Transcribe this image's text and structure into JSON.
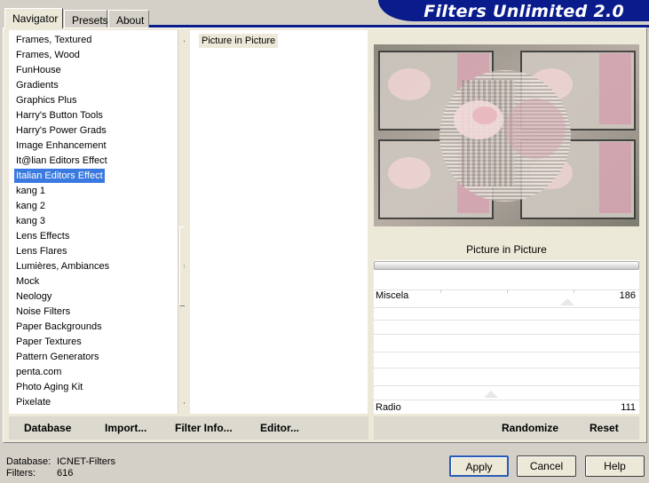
{
  "tabs": [
    {
      "label": "Navigator"
    },
    {
      "label": "Presets"
    },
    {
      "label": "About"
    }
  ],
  "app_title": "Filters Unlimited 2.0",
  "filter_list": [
    "Frames, Textured",
    "Frames, Wood",
    "FunHouse",
    "Gradients",
    "Graphics Plus",
    "Harry's Button Tools",
    "Harry's Power Grads",
    "Image Enhancement",
    "It@lian Editors Effect",
    "Italian Editors Effect",
    "kang 1",
    "kang 2",
    "kang 3",
    "Lens Effects",
    "Lens Flares",
    "Lumières, Ambiances",
    "Mock",
    "Neology",
    "Noise Filters",
    "Paper Backgrounds",
    "Paper Textures",
    "Pattern Generators",
    "penta.com",
    "Photo Aging Kit",
    "Pixelate"
  ],
  "selected_filter": "Italian Editors Effect",
  "effect_list": [
    "Picture in Picture"
  ],
  "filter_name": "Picture in Picture",
  "sliders": [
    {
      "label": "Miscela",
      "value": "186",
      "fraction": 0.73
    },
    {
      "label": "Radio",
      "value": "111",
      "fraction": 0.44
    }
  ],
  "toolbar": {
    "database": "Database",
    "import": "Import...",
    "filter_info": "Filter Info...",
    "editor": "Editor...",
    "randomize": "Randomize",
    "reset": "Reset"
  },
  "status": {
    "database_label": "Database:",
    "database_value": "ICNET-Filters",
    "filters_label": "Filters:",
    "filters_value": "616"
  },
  "buttons": {
    "apply": "Apply",
    "cancel": "Cancel",
    "help": "Help"
  },
  "colors": {
    "accent": "#0a1c8c",
    "selection": "#3a79e0"
  }
}
